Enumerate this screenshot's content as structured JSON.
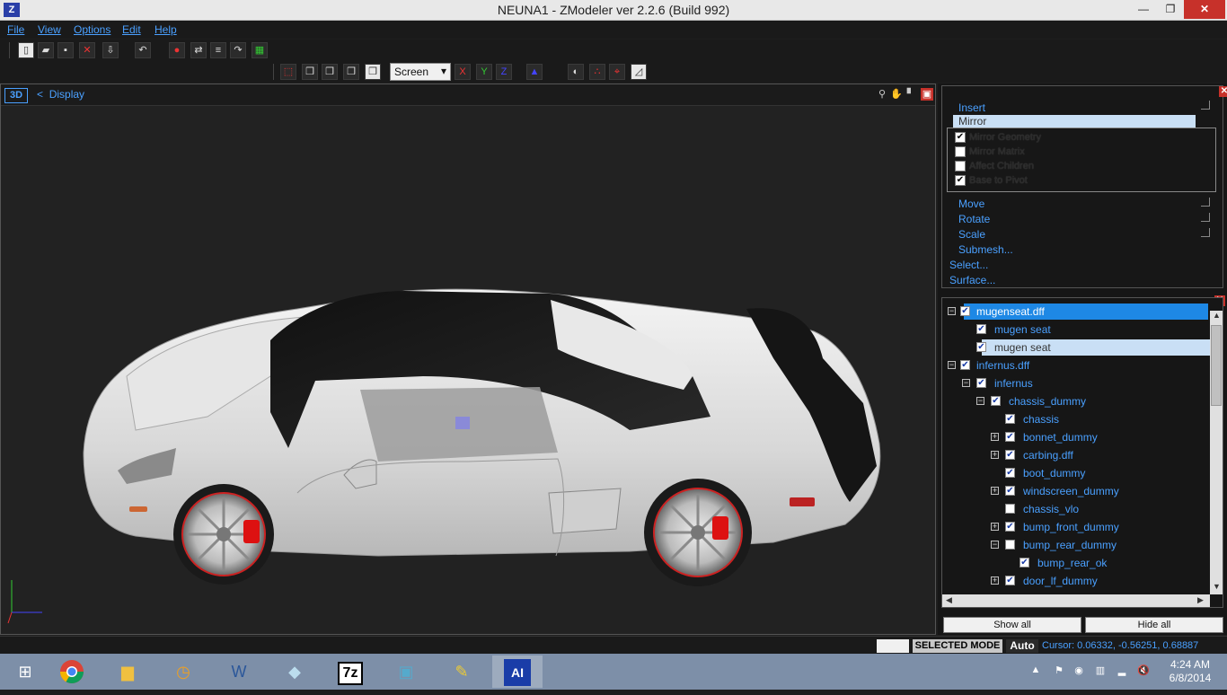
{
  "window": {
    "title": "NEUNA1 - ZModeler ver 2.2.6 (Build 992)",
    "minimize": "—",
    "maximize": "❐",
    "close": "✕"
  },
  "menu": {
    "items": [
      {
        "label": "File"
      },
      {
        "label": "View"
      },
      {
        "label": "Options"
      },
      {
        "label": "Edit"
      },
      {
        "label": "Help"
      }
    ]
  },
  "toolbar": {
    "screen_select": "Screen",
    "axis_x": "X",
    "axis_y": "Y",
    "axis_z": "Z"
  },
  "viewport": {
    "mode": "3D",
    "back_arrow": "<",
    "display_label": "Display"
  },
  "modify_panel": {
    "insert": "Insert",
    "mirror": "Mirror",
    "options": [
      {
        "label": "Mirror Geometry",
        "checked": true
      },
      {
        "label": "Mirror Matrix",
        "checked": false
      },
      {
        "label": "Affect Children",
        "checked": false
      },
      {
        "label": "Base to Pivot",
        "checked": true
      }
    ],
    "move": "Move",
    "rotate": "Rotate",
    "scale": "Scale",
    "submesh": "Submesh...",
    "select": "Select...",
    "surface": "Surface..."
  },
  "tree": {
    "rows": [
      {
        "label": "mugenseat.dff",
        "level": 0,
        "toggle": "−",
        "checked": true,
        "state": "selected"
      },
      {
        "label": "mugen seat",
        "level": 1,
        "toggle": "",
        "checked": true,
        "state": ""
      },
      {
        "label": "mugen seat",
        "level": 1,
        "toggle": "",
        "checked": true,
        "state": "highlight"
      },
      {
        "label": "infernus.dff",
        "level": 0,
        "toggle": "−",
        "checked": true,
        "state": ""
      },
      {
        "label": "infernus",
        "level": 1,
        "toggle": "−",
        "checked": true,
        "state": ""
      },
      {
        "label": "chassis_dummy",
        "level": 2,
        "toggle": "−",
        "checked": true,
        "state": ""
      },
      {
        "label": "chassis",
        "level": 3,
        "toggle": "",
        "checked": true,
        "state": ""
      },
      {
        "label": "bonnet_dummy",
        "level": 3,
        "toggle": "+",
        "checked": true,
        "state": ""
      },
      {
        "label": "carbing.dff",
        "level": 3,
        "toggle": "+",
        "checked": true,
        "state": ""
      },
      {
        "label": "boot_dummy",
        "level": 3,
        "toggle": "",
        "checked": true,
        "state": ""
      },
      {
        "label": "windscreen_dummy",
        "level": 3,
        "toggle": "+",
        "checked": true,
        "state": ""
      },
      {
        "label": "chassis_vlo",
        "level": 3,
        "toggle": "",
        "checked": false,
        "state": ""
      },
      {
        "label": "bump_front_dummy",
        "level": 3,
        "toggle": "+",
        "checked": true,
        "state": ""
      },
      {
        "label": "bump_rear_dummy",
        "level": 3,
        "toggle": "−",
        "checked": false,
        "state": ""
      },
      {
        "label": "bump_rear_ok",
        "level": 4,
        "toggle": "",
        "checked": true,
        "state": ""
      },
      {
        "label": "door_lf_dummy",
        "level": 3,
        "toggle": "+",
        "checked": true,
        "state": ""
      }
    ],
    "show_all": "Show all",
    "hide_all": "Hide all"
  },
  "status": {
    "mode": "SELECTED MODE",
    "auto": "Auto",
    "cursor": "Cursor: 0.06332, -0.56251, 0.68887"
  },
  "taskbar": {
    "time": "4:24 AM",
    "date": "6/8/2014"
  }
}
